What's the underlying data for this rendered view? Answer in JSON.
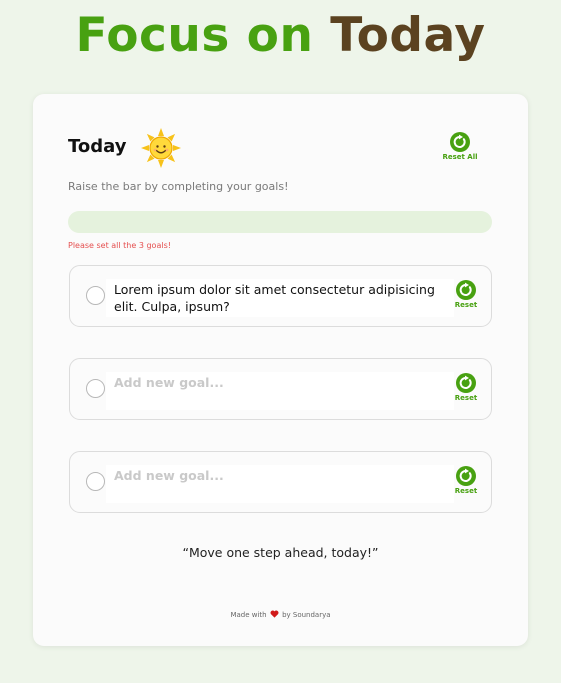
{
  "header": {
    "title_part1": "Focus on",
    "title_part2": "Today"
  },
  "card": {
    "heading": "Today",
    "heading_icon": "sun-icon",
    "reset_all_label": "Reset All",
    "subtitle": "Raise the bar by completing your goals!",
    "progress": {
      "completed": 0,
      "total": 3
    },
    "error": "Please set all the 3 goals!",
    "goals": [
      {
        "value": "Lorem ipsum dolor sit amet consectetur adipisicing elit. Culpa, ipsum?",
        "placeholder": "Add new goal...",
        "completed": false,
        "reset_label": "Reset"
      },
      {
        "value": "",
        "placeholder": "Add new goal...",
        "completed": false,
        "reset_label": "Reset"
      },
      {
        "value": "",
        "placeholder": "Add new goal...",
        "completed": false,
        "reset_label": "Reset"
      }
    ],
    "quote": "“Move one step ahead, today!”",
    "footer": {
      "made_with": "Made with",
      "by": "by Soundarya",
      "icon": "heart-icon"
    }
  },
  "colors": {
    "accent_green": "#48a111",
    "title_brown": "#5b4220",
    "progress_track": "#e5f2dd",
    "error_red": "#e55050",
    "page_background": "#eef5ea"
  }
}
